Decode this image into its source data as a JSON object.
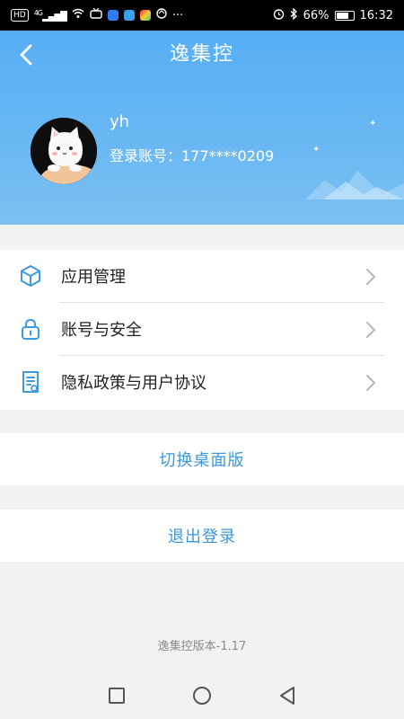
{
  "statusbar": {
    "hd": "HD",
    "signal": "4G",
    "battery": "66%",
    "battery_level": 0.66,
    "time": "16:32",
    "more": "···"
  },
  "header": {
    "title": "逸集控",
    "username": "yh",
    "account_line": "登录账号：177****0209"
  },
  "menu": {
    "items": [
      {
        "label": "应用管理",
        "icon": "cube-icon"
      },
      {
        "label": "账号与安全",
        "icon": "lock-icon"
      },
      {
        "label": "隐私政策与用户协议",
        "icon": "document-icon"
      }
    ]
  },
  "actions": {
    "switch_desktop": "切换桌面版",
    "logout": "退出登录"
  },
  "footer": {
    "version": "逸集控版本-1.17"
  },
  "colors": {
    "header_blue": "#57aef4",
    "action_blue": "#3b97da",
    "icon_blue": "#3d9be0"
  }
}
